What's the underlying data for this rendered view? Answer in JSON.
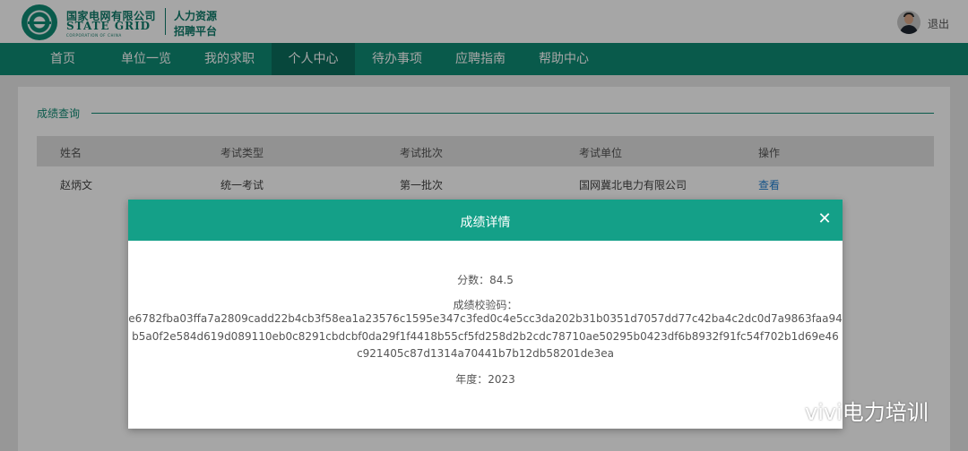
{
  "header": {
    "brand_cn": "国家电网有限公司",
    "brand_en": "STATE GRID",
    "brand_sub": "CORPORATION OF CHINA",
    "brand_right_line1": "人力资源",
    "brand_right_line2": "招聘平台",
    "logout_label": "退出"
  },
  "nav": {
    "items": [
      {
        "label": "首页"
      },
      {
        "label": "单位一览"
      },
      {
        "label": "我的求职"
      },
      {
        "label": "个人中心"
      },
      {
        "label": "待办事项"
      },
      {
        "label": "应聘指南"
      },
      {
        "label": "帮助中心"
      }
    ],
    "active": "个人中心"
  },
  "section": {
    "title": "成绩查询"
  },
  "table": {
    "columns": [
      "姓名",
      "考试类型",
      "考试批次",
      "考试单位",
      "操作"
    ],
    "rows": [
      [
        "赵炳文",
        "统一考试",
        "第一批次",
        "国网冀北电力有限公司",
        "查看"
      ]
    ]
  },
  "modal": {
    "title": "成绩详情",
    "score_line": "分数：84.5",
    "hash_label": "成绩校验码：",
    "hash_lines": [
      "e6782fba03ffa7a2809cadd22b4cb3f58ea1a23576c1595e347c3fed0c4e5cc3da202b31b0351d7057dd77c42ba4c2dc0d7a9863faa94",
      "b5a0f2e584d619d089110eb0c8291cbdcbf0da29f1f4418b55cf5fd258d2b2cdc78710ae50295b0423df6b8932f91fc54f702b1d69e46",
      "c921405c87d1314a70441b7b12db58201de3ea"
    ],
    "year_line": "年度：2023",
    "close_icon": "close-icon"
  },
  "watermark": {
    "text": "vivi电力培训",
    "icon": "wechat-icon"
  },
  "colors": {
    "brand_green": "#0f8a74",
    "modal_header": "#14a088",
    "link_blue": "#1e7fd1"
  }
}
